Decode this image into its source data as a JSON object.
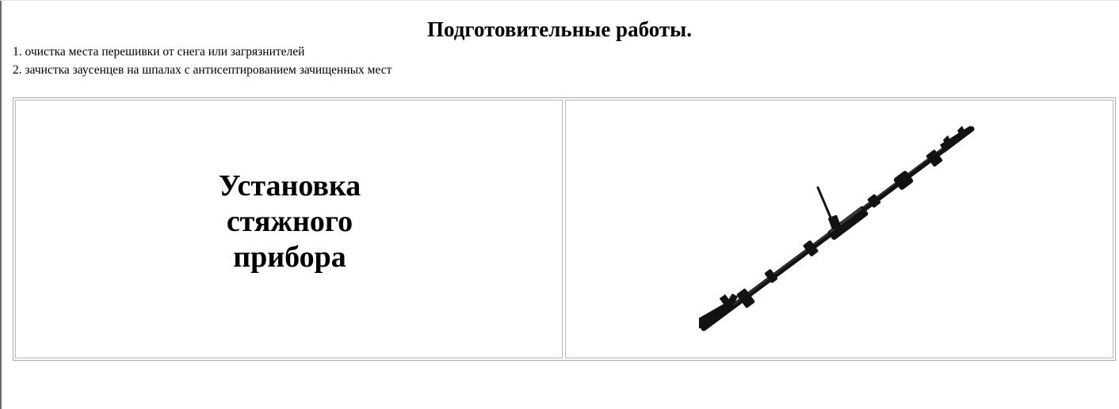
{
  "page": {
    "title": "Подготовительные работы."
  },
  "steps": [
    "1. очистка места перешивки от снега или загрязнителей",
    "2. зачистка заусенцев на шпалах с антисептированием зачищенных мест"
  ],
  "section": {
    "caption": "Установка стяжного прибора"
  },
  "image": {
    "subject": "tensioning-device",
    "colors": {
      "body": "#121212",
      "highlight": "#3a3a3a"
    }
  }
}
